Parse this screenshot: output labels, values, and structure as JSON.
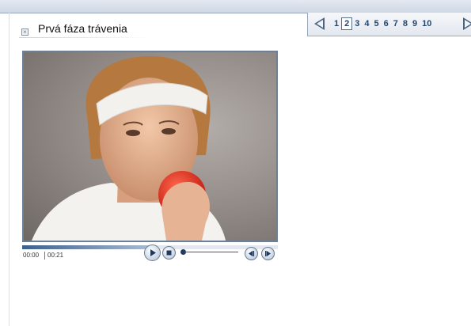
{
  "title": "Prvá fáza trávenia",
  "pager": {
    "pages": [
      "1",
      "2",
      "3",
      "4",
      "5",
      "6",
      "7",
      "8",
      "9",
      "10"
    ],
    "active_index": 1
  },
  "player": {
    "current_time": "00:00",
    "duration": "00:21"
  },
  "icons": {
    "close": "close-icon",
    "prev": "triangle-left-icon",
    "next": "triangle-right-icon",
    "play": "play-icon",
    "stop": "stop-icon",
    "rewind": "rewind-icon",
    "forward": "fast-forward-icon"
  },
  "colors": {
    "accent": "#26466e",
    "frame": "#6d8099"
  }
}
